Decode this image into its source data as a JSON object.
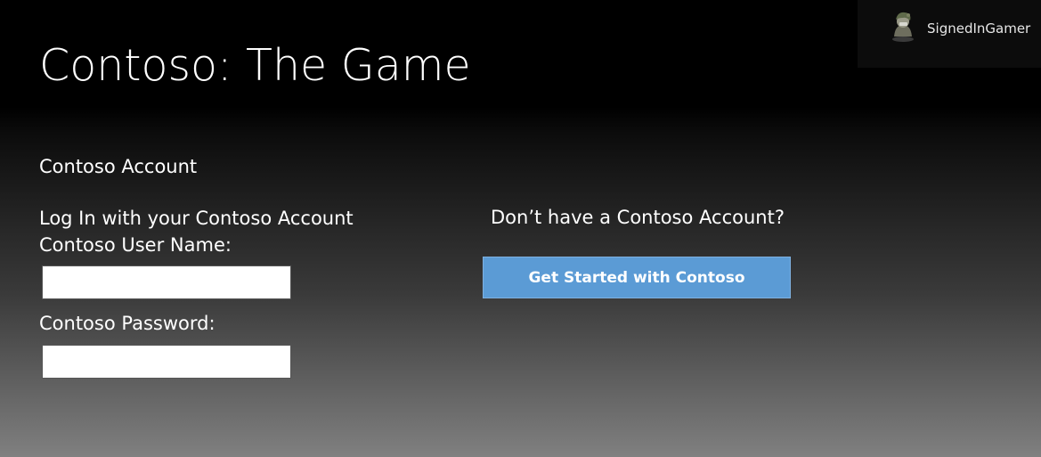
{
  "app": {
    "title": "Contoso: The Game"
  },
  "profile": {
    "gamertag": "SignedInGamer",
    "avatar_icon": "gamer-avatar-icon"
  },
  "account": {
    "section_heading": "Contoso Account",
    "login_heading": "Log In with your Contoso Account",
    "username_label": "Contoso User Name:",
    "username_value": "",
    "password_label": "Contoso Password:",
    "password_value": ""
  },
  "signup": {
    "prompt": "Don’t have a Contoso Account?",
    "button_label": "Get Started with Contoso"
  },
  "colors": {
    "button_background": "#5b9bd5",
    "page_top": "#000000",
    "page_bottom": "#808080"
  }
}
